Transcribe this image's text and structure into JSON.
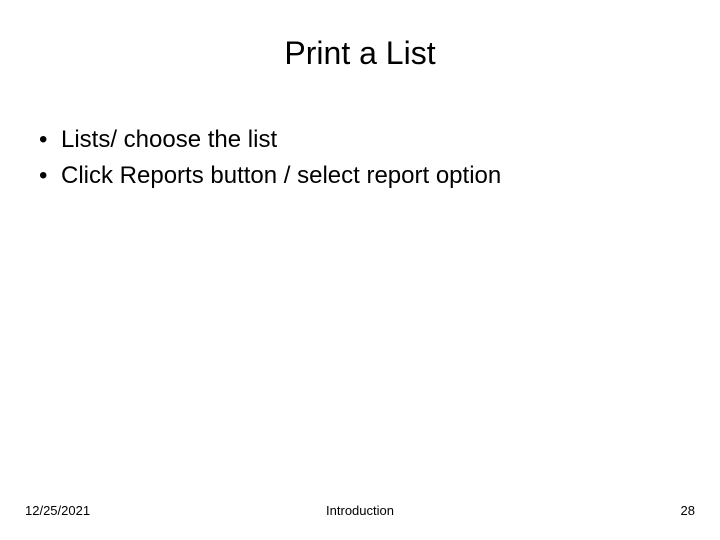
{
  "slide": {
    "title": "Print a List",
    "bullets": [
      "Lists/ choose the list",
      "Click Reports button / select report option"
    ]
  },
  "footer": {
    "date": "12/25/2021",
    "title": "Introduction",
    "page": "28"
  }
}
